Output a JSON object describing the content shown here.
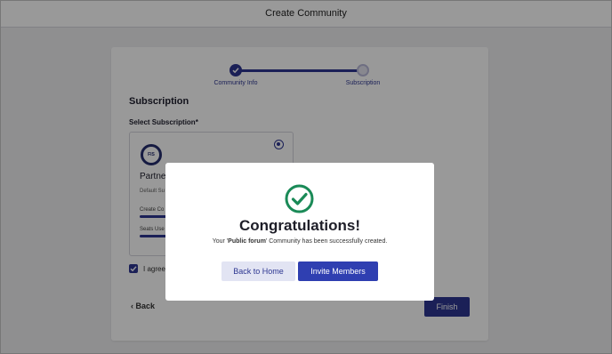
{
  "header": {
    "title": "Create Community"
  },
  "stepper": {
    "steps": [
      {
        "label": "Community Info",
        "status": "completed"
      },
      {
        "label": "Subscription",
        "status": "current"
      }
    ]
  },
  "subscription": {
    "section_title": "Subscription",
    "select_label": "Select Subscription",
    "required_marker": "*",
    "plan": {
      "logo_text": "FIS",
      "name": "Partne",
      "description": "Default Su",
      "selected": true,
      "usage": [
        {
          "label": "Create Co"
        },
        {
          "label": "Seats Use"
        }
      ]
    }
  },
  "agreement": {
    "label": "I agree",
    "checked": true
  },
  "footer": {
    "back_label": "Back",
    "finish_label": "Finish"
  },
  "modal": {
    "title": "Congratulations!",
    "message_prefix": "Your '",
    "community_name": "Public forum",
    "message_suffix": "' Community has been successfully created.",
    "back_home_label": "Back to Home",
    "invite_label": "Invite Members"
  },
  "colors": {
    "primary": "#2d3691",
    "success": "#1a8a57",
    "invite_button": "#2f3fb1",
    "back_home_button": "#e2e4f3"
  },
  "icons": {
    "step_complete": "check-icon",
    "success": "check-circle-icon",
    "back": "chevron-left-icon"
  }
}
